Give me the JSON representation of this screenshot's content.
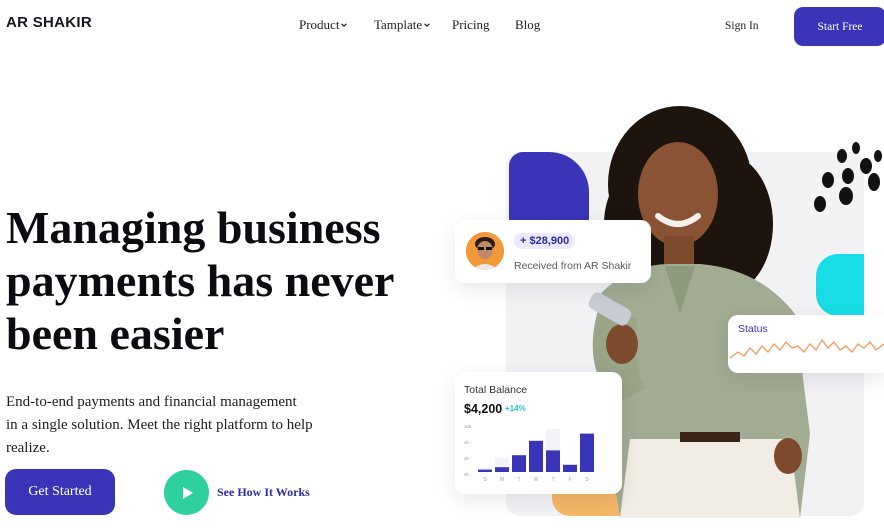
{
  "brand": {
    "name": "AR SHAKIR"
  },
  "nav": {
    "items": [
      {
        "label": "Product",
        "has_dropdown": true
      },
      {
        "label": "Tamplate",
        "has_dropdown": true
      },
      {
        "label": "Pricing",
        "has_dropdown": false
      },
      {
        "label": "Blog",
        "has_dropdown": false
      }
    ],
    "signin_label": "Sign In",
    "start_free_label": "Start Free"
  },
  "hero": {
    "title_line1": "Managing business",
    "title_line2": "payments has never",
    "title_line3": "been easier",
    "desc_line1": "End-to-end payments and financial management",
    "desc_line2": "in a single solution. Meet the right platform to help",
    "desc_line3": "realize.",
    "cta_primary": "Get Started",
    "cta_secondary": "See How It Works"
  },
  "cards": {
    "received": {
      "amount": "+ $28,900",
      "text": "Received from AR Shakir"
    },
    "status": {
      "label": "Status"
    },
    "balance": {
      "label": "Total Balance",
      "value": "$4,200",
      "change": "+14%",
      "chart_data": {
        "type": "bar",
        "categories": [
          "S",
          "M",
          "T",
          "W",
          "T",
          "F",
          "S"
        ],
        "y_ticks": [
          "10k",
          "4k",
          "2k",
          "0k"
        ],
        "series": [
          {
            "values": [
              1.0,
              3.0,
              1.5,
              2.5,
              9.0,
              1.0,
              2.5
            ]
          },
          {
            "values": [
              0.5,
              1.0,
              3.5,
              6.5,
              4.5,
              1.5,
              8.0
            ]
          }
        ]
      }
    }
  },
  "colors": {
    "accent": "#3a35b8",
    "play": "#2fd0a0",
    "cyan": "#19dde6",
    "orange": "#f6b867"
  }
}
